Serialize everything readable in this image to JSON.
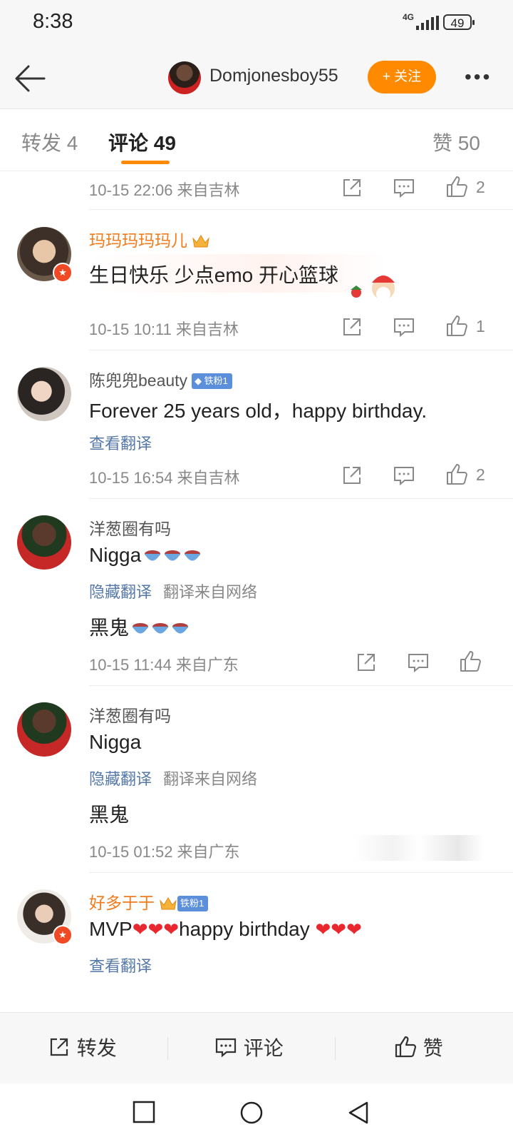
{
  "status": {
    "time": "8:38",
    "network": "4G",
    "battery": "49"
  },
  "header": {
    "back_icon": "back-arrow-icon",
    "username": "Domjonesboy55",
    "follow_label": "+ 关注",
    "more_icon": "more-dots-icon"
  },
  "tabs": [
    {
      "label": "转发 4"
    },
    {
      "label": "评论 49"
    },
    {
      "label": "赞 50"
    }
  ],
  "comments": [
    {
      "meta": "10-15 22:06  来自吉林",
      "likes": "2"
    },
    {
      "user": "玛玛玛玛玛儿",
      "text": "生日快乐 少点emo 开心篮球",
      "meta": "10-15 10:11  来自吉林",
      "likes": "1"
    },
    {
      "user": "陈兜兜beauty",
      "badge": "铁粉1",
      "text": "Forever 25 years old，happy birthday.",
      "link": "查看翻译",
      "meta": "10-15 16:54  来自吉林",
      "likes": "2"
    },
    {
      "user": "洋葱圈有吗",
      "text": "Nigga",
      "link": "隐藏翻译",
      "note": "翻译来自网络",
      "translation": "黑鬼",
      "meta": "10-15 11:44  来自广东"
    },
    {
      "user": "洋葱圈有吗",
      "text": "Nigga",
      "link": "隐藏翻译",
      "note": "翻译来自网络",
      "translation": "黑鬼",
      "meta": "10-15 01:52  来自广东"
    },
    {
      "user": "好多于于",
      "badge": "铁粉1",
      "text_a": "MVP",
      "text_b": "happy birthday",
      "link": "查看翻译"
    }
  ],
  "bottom": {
    "repost": "转发",
    "comment": "评论",
    "like": "赞"
  },
  "colors": {
    "accent": "#ff8a00",
    "link": "#5578a8",
    "vip_name": "#f27b1c",
    "heart": "#e8282e"
  }
}
